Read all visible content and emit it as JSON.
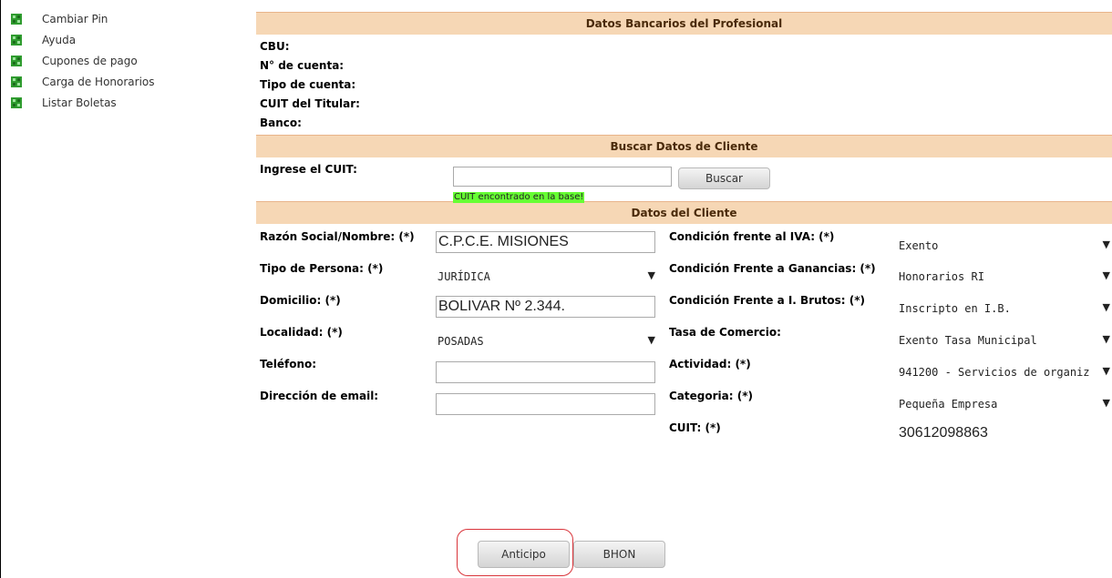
{
  "sidebar": {
    "items": [
      {
        "label": "Cambiar Pin"
      },
      {
        "label": "Ayuda"
      },
      {
        "label": "Cupones de pago"
      },
      {
        "label": "Carga de Honorarios"
      },
      {
        "label": "Listar Boletas"
      }
    ],
    "icon": "green-puzzle-icon",
    "icon_color": "#2e9b2e"
  },
  "bank": {
    "header": "Datos Bancarios del Profesional",
    "labels": [
      "CBU:",
      "N° de cuenta:",
      "Tipo de cuenta:",
      "CUIT del Titular:",
      "Banco:"
    ]
  },
  "search": {
    "header": "Buscar Datos de Cliente",
    "label": "Ingrese el CUIT:",
    "value": "",
    "button": "Buscar",
    "found_message": "CUIT encontrado en la base!"
  },
  "client": {
    "header": "Datos del Cliente",
    "razon_label": "Razón Social/Nombre: (*)",
    "razon_value": "C.P.C.E. MISIONES",
    "tipo_label": "Tipo de Persona: (*)",
    "tipo_value": "JURÍDICA",
    "domicilio_label": "Domicilio: (*)",
    "domicilio_value": "BOLIVAR Nº 2.344.",
    "localidad_label": "Localidad: (*)",
    "localidad_value": "POSADAS",
    "telefono_label": "Teléfono:",
    "telefono_value": "",
    "email_label": "Dirección de email:",
    "email_value": "",
    "iva_label": "Condición frente al IVA: (*)",
    "iva_value": "Exento",
    "ganancias_label": "Condición Frente a Ganancias: (*)",
    "ganancias_value": "Honorarios RI",
    "brutos_label": "Condición Frente a I. Brutos: (*)",
    "brutos_value": "Inscripto en I.B.",
    "tasa_label": "Tasa de Comercio:",
    "tasa_value": "Exento Tasa Municipal",
    "actividad_label": "Actividad: (*)",
    "actividad_value": "941200 - Servicios de organiz",
    "categoria_label": "Categoria: (*)",
    "categoria_value": "Pequeña Empresa",
    "cuit_label": "CUIT: (*)",
    "cuit_value": "30612098863"
  },
  "actions": {
    "anticipo": "Anticipo",
    "bhon": "BHON"
  },
  "colors": {
    "header_bg": "#f6d7b5",
    "found_bg": "#66ff33",
    "highlight_circle": "#d9343a"
  }
}
